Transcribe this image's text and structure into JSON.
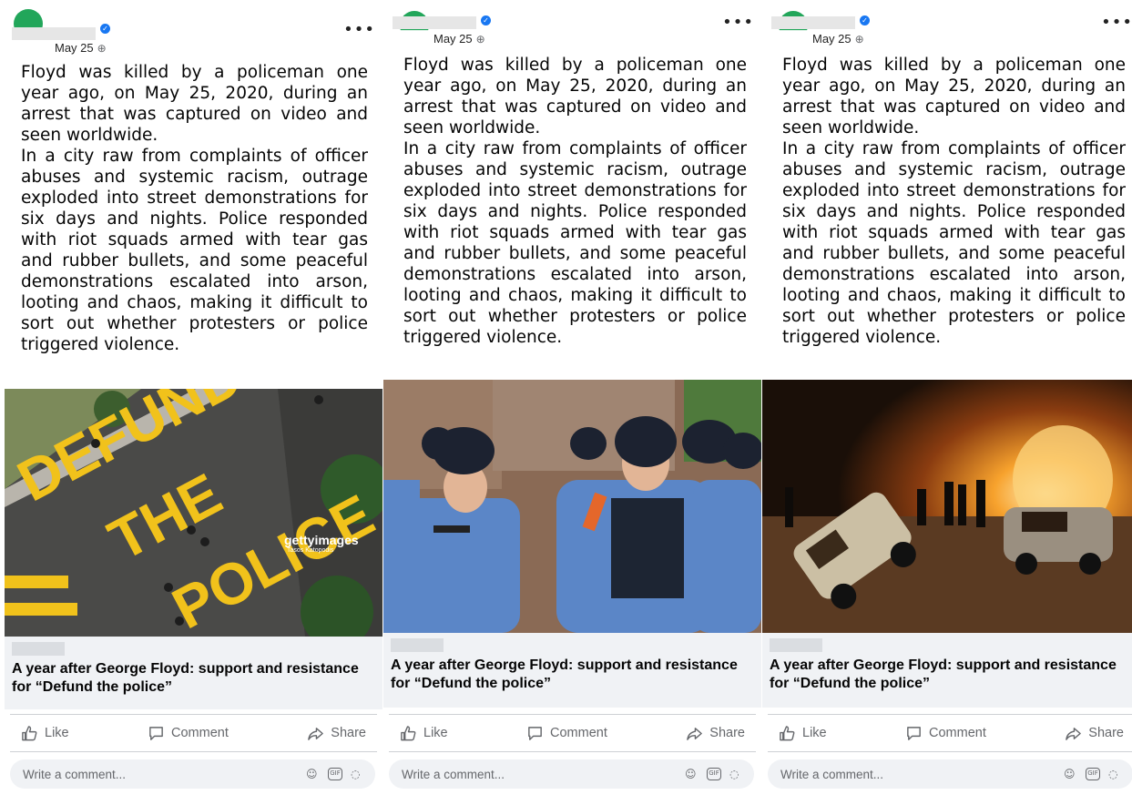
{
  "posts": [
    {
      "date": "May 25",
      "paragraphs": [
        "Floyd was killed by a policeman one year ago, on May 25, 2020, during an arrest that was captured on video and seen worldwide.",
        "In a city raw from complaints of officer abuses and systemic racism, outrage exploded into street demonstrations for six days and nights. Police responded with riot squads armed with tear gas and rubber bullets, and some peaceful demonstrations escalated into arson, looting and chaos, making it difficult to sort out whether protesters or police triggered violence."
      ],
      "link_title": "A year after George Floyd: support and resistance for “Defund the police”",
      "image_text": "DEFUND THE POLICE",
      "watermark": "gettyimages",
      "watermark_credit": "Tasos Katopodis"
    },
    {
      "date": "May 25",
      "paragraphs": [
        "Floyd was killed by a policeman one year ago, on May 25, 2020, during an arrest that was captured on video and seen worldwide.",
        "In a city raw from complaints of officer abuses and systemic racism, outrage exploded into street demonstrations for six days and nights. Police responded with riot squads armed with tear gas and rubber bullets, and some peaceful demonstrations escalated into arson, looting and chaos, making it difficult to sort out whether protesters or police triggered violence."
      ],
      "link_title": "A year after George Floyd: support and resistance for “Defund the police”"
    },
    {
      "date": "May 25",
      "paragraphs": [
        "Floyd was killed by a policeman one year ago, on May 25, 2020, during an arrest that was captured on video and seen worldwide.",
        "In a city raw from complaints of officer abuses and systemic racism, outrage exploded into street demonstrations for six days and nights. Police responded with riot squads armed with tear gas and rubber bullets, and some peaceful demonstrations escalated into arson, looting and chaos, making it difficult to sort out whether protesters or police triggered violence."
      ],
      "link_title": "A year after George Floyd: support and resistance for “Defund the police”"
    }
  ],
  "actions": {
    "like": "Like",
    "comment": "Comment",
    "share": "Share"
  },
  "comment_placeholder": "Write a comment...",
  "icons": [
    "more-icon",
    "globe-icon",
    "verified-icon",
    "like-icon",
    "comment-icon",
    "share-icon",
    "emoji-icon",
    "gif-icon",
    "sticker-icon"
  ],
  "colors": {
    "accent": "#1877f2",
    "avatar": "#22a65a",
    "muted": "#65676b",
    "link_box": "#f0f2f5",
    "road_paint": "#f1c21b"
  }
}
